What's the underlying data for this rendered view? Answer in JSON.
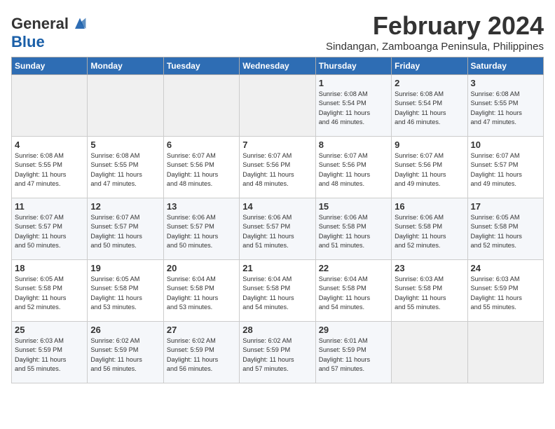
{
  "logo": {
    "line1": "General",
    "line2": "Blue"
  },
  "title": "February 2024",
  "subtitle": "Sindangan, Zamboanga Peninsula, Philippines",
  "days_of_week": [
    "Sunday",
    "Monday",
    "Tuesday",
    "Wednesday",
    "Thursday",
    "Friday",
    "Saturday"
  ],
  "weeks": [
    [
      {
        "day": "",
        "info": ""
      },
      {
        "day": "",
        "info": ""
      },
      {
        "day": "",
        "info": ""
      },
      {
        "day": "",
        "info": ""
      },
      {
        "day": "1",
        "info": "Sunrise: 6:08 AM\nSunset: 5:54 PM\nDaylight: 11 hours\nand 46 minutes."
      },
      {
        "day": "2",
        "info": "Sunrise: 6:08 AM\nSunset: 5:54 PM\nDaylight: 11 hours\nand 46 minutes."
      },
      {
        "day": "3",
        "info": "Sunrise: 6:08 AM\nSunset: 5:55 PM\nDaylight: 11 hours\nand 47 minutes."
      }
    ],
    [
      {
        "day": "4",
        "info": "Sunrise: 6:08 AM\nSunset: 5:55 PM\nDaylight: 11 hours\nand 47 minutes."
      },
      {
        "day": "5",
        "info": "Sunrise: 6:08 AM\nSunset: 5:55 PM\nDaylight: 11 hours\nand 47 minutes."
      },
      {
        "day": "6",
        "info": "Sunrise: 6:07 AM\nSunset: 5:56 PM\nDaylight: 11 hours\nand 48 minutes."
      },
      {
        "day": "7",
        "info": "Sunrise: 6:07 AM\nSunset: 5:56 PM\nDaylight: 11 hours\nand 48 minutes."
      },
      {
        "day": "8",
        "info": "Sunrise: 6:07 AM\nSunset: 5:56 PM\nDaylight: 11 hours\nand 48 minutes."
      },
      {
        "day": "9",
        "info": "Sunrise: 6:07 AM\nSunset: 5:56 PM\nDaylight: 11 hours\nand 49 minutes."
      },
      {
        "day": "10",
        "info": "Sunrise: 6:07 AM\nSunset: 5:57 PM\nDaylight: 11 hours\nand 49 minutes."
      }
    ],
    [
      {
        "day": "11",
        "info": "Sunrise: 6:07 AM\nSunset: 5:57 PM\nDaylight: 11 hours\nand 50 minutes."
      },
      {
        "day": "12",
        "info": "Sunrise: 6:07 AM\nSunset: 5:57 PM\nDaylight: 11 hours\nand 50 minutes."
      },
      {
        "day": "13",
        "info": "Sunrise: 6:06 AM\nSunset: 5:57 PM\nDaylight: 11 hours\nand 50 minutes."
      },
      {
        "day": "14",
        "info": "Sunrise: 6:06 AM\nSunset: 5:57 PM\nDaylight: 11 hours\nand 51 minutes."
      },
      {
        "day": "15",
        "info": "Sunrise: 6:06 AM\nSunset: 5:58 PM\nDaylight: 11 hours\nand 51 minutes."
      },
      {
        "day": "16",
        "info": "Sunrise: 6:06 AM\nSunset: 5:58 PM\nDaylight: 11 hours\nand 52 minutes."
      },
      {
        "day": "17",
        "info": "Sunrise: 6:05 AM\nSunset: 5:58 PM\nDaylight: 11 hours\nand 52 minutes."
      }
    ],
    [
      {
        "day": "18",
        "info": "Sunrise: 6:05 AM\nSunset: 5:58 PM\nDaylight: 11 hours\nand 52 minutes."
      },
      {
        "day": "19",
        "info": "Sunrise: 6:05 AM\nSunset: 5:58 PM\nDaylight: 11 hours\nand 53 minutes."
      },
      {
        "day": "20",
        "info": "Sunrise: 6:04 AM\nSunset: 5:58 PM\nDaylight: 11 hours\nand 53 minutes."
      },
      {
        "day": "21",
        "info": "Sunrise: 6:04 AM\nSunset: 5:58 PM\nDaylight: 11 hours\nand 54 minutes."
      },
      {
        "day": "22",
        "info": "Sunrise: 6:04 AM\nSunset: 5:58 PM\nDaylight: 11 hours\nand 54 minutes."
      },
      {
        "day": "23",
        "info": "Sunrise: 6:03 AM\nSunset: 5:58 PM\nDaylight: 11 hours\nand 55 minutes."
      },
      {
        "day": "24",
        "info": "Sunrise: 6:03 AM\nSunset: 5:59 PM\nDaylight: 11 hours\nand 55 minutes."
      }
    ],
    [
      {
        "day": "25",
        "info": "Sunrise: 6:03 AM\nSunset: 5:59 PM\nDaylight: 11 hours\nand 55 minutes."
      },
      {
        "day": "26",
        "info": "Sunrise: 6:02 AM\nSunset: 5:59 PM\nDaylight: 11 hours\nand 56 minutes."
      },
      {
        "day": "27",
        "info": "Sunrise: 6:02 AM\nSunset: 5:59 PM\nDaylight: 11 hours\nand 56 minutes."
      },
      {
        "day": "28",
        "info": "Sunrise: 6:02 AM\nSunset: 5:59 PM\nDaylight: 11 hours\nand 57 minutes."
      },
      {
        "day": "29",
        "info": "Sunrise: 6:01 AM\nSunset: 5:59 PM\nDaylight: 11 hours\nand 57 minutes."
      },
      {
        "day": "",
        "info": ""
      },
      {
        "day": "",
        "info": ""
      }
    ]
  ]
}
